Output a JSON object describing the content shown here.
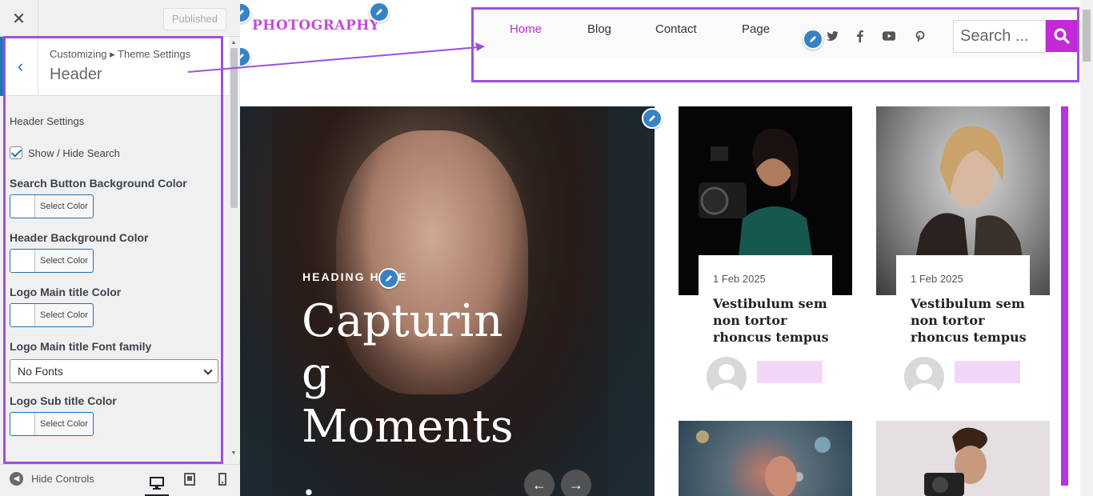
{
  "customizer": {
    "close_icon": "close-icon",
    "status_label": "Published",
    "breadcrumb": "Customizing ▸ Theme Settings",
    "panel_title": "Header",
    "section_title": "Header Settings",
    "show_hide_search_label": "Show / Hide Search",
    "show_hide_search_checked": true,
    "controls": [
      {
        "label": "Search Button Background Color",
        "button": "Select Color"
      },
      {
        "label": "Header Background Color",
        "button": "Select Color"
      },
      {
        "label": "Logo Main title Color",
        "button": "Select Color"
      }
    ],
    "font_family_label": "Logo Main title Font family",
    "font_family_value": "No Fonts",
    "sub_title_label": "Logo Sub title Color",
    "sub_title_button": "Select Color",
    "hide_controls": "Hide Controls",
    "devices": [
      "desktop-icon",
      "tablet-icon",
      "mobile-icon"
    ],
    "accent_color": "#2271b1",
    "highlight_color": "#9b51e0"
  },
  "site": {
    "logo_text": "PHOTOGRAPHY",
    "nav": [
      {
        "label": "Home",
        "active": true
      },
      {
        "label": "Blog",
        "active": false
      },
      {
        "label": "Contact",
        "active": false
      },
      {
        "label": "Page",
        "active": false
      }
    ],
    "social_icons": [
      "twitter-icon",
      "facebook-icon",
      "youtube-icon",
      "pinterest-icon"
    ],
    "search_placeholder": "Search ...",
    "brand_color": "#c22ad6",
    "hero": {
      "kicker": "HEADING HERE",
      "title": "Capturing Moments."
    },
    "posts": [
      {
        "date": "1 Feb 2025",
        "title": "Vestibulum sem non tortor rhoncus tempus"
      },
      {
        "date": "1 Feb 2025",
        "title": "Vestibulum sem non tortor rhoncus tempus"
      }
    ]
  }
}
